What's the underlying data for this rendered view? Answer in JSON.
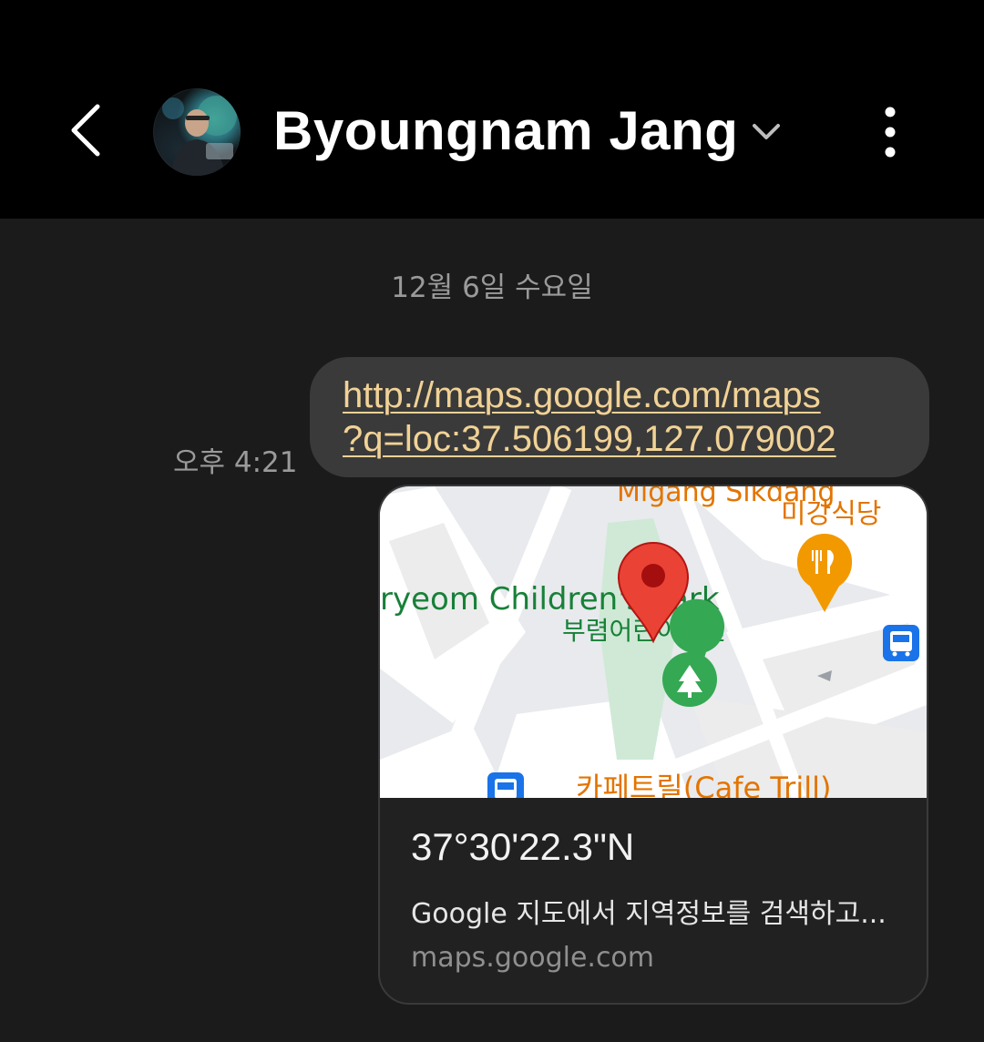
{
  "header": {
    "contact_name": "Byoungnam Jang"
  },
  "conversation": {
    "date_separator": "12월 6일 수요일",
    "message": {
      "time": "오후 4:21",
      "link_line1": "http://maps.google.com/maps",
      "link_line2": "?q=loc:37.506199,127.079002"
    },
    "preview": {
      "title": "37°30'22.3\"N",
      "description": "Google 지도에서 지역정보를 검색하고...",
      "domain": "maps.google.com",
      "map_labels": {
        "park_en": "ryeom Children's Park",
        "park_ko": "부렴어린이공원",
        "restaurant_en": "Migang Sikdang",
        "restaurant_ko": "미강식당",
        "cafe": "카페트릴(Cafe Trill)"
      }
    }
  },
  "icons": [
    "back-icon",
    "chevron-down-icon",
    "more-vert-icon",
    "map-pin-icon",
    "restaurant-icon",
    "park-icon",
    "bus-stop-icon"
  ],
  "colors": {
    "background": "#1b1b1b",
    "topbar": "#000000",
    "bubble": "#3a3a3a",
    "link": "#f1d296",
    "pin": "#ea4335",
    "park_green": "#34a853",
    "restaurant_orange": "#f29900",
    "bus_blue": "#1a73e8"
  }
}
